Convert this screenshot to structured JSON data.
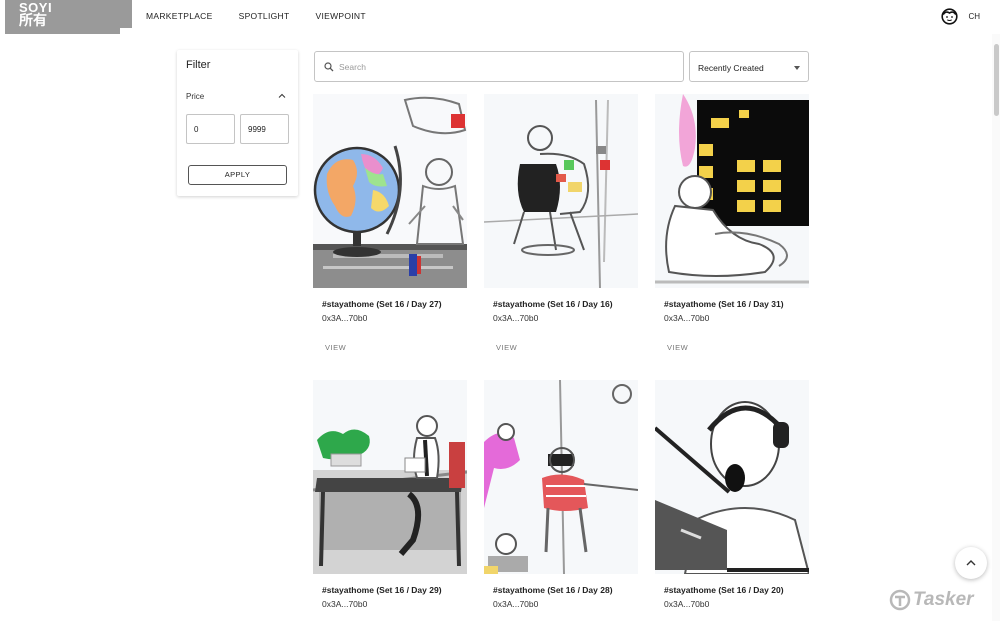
{
  "header": {
    "logo_line1": "SOYI",
    "logo_line2": "所有",
    "nav": [
      "MARKETPLACE",
      "SPOTLIGHT",
      "VIEWPOINT"
    ],
    "language": "CH"
  },
  "filter": {
    "title": "Filter",
    "price_label": "Price",
    "min_value": "0",
    "max_value": "9999",
    "apply_label": "APPLY"
  },
  "search": {
    "placeholder": "Search",
    "sort_selected": "Recently Created"
  },
  "cards": [
    {
      "title": "#stayathome (Set 16 / Day 27)",
      "owner": "0x3A...70b0",
      "action": "VIEW"
    },
    {
      "title": "#stayathome (Set 16 / Day 16)",
      "owner": "0x3A...70b0",
      "action": "VIEW"
    },
    {
      "title": "#stayathome (Set 16 / Day 31)",
      "owner": "0x3A...70b0",
      "action": "VIEW"
    },
    {
      "title": "#stayathome (Set 16 / Day 29)",
      "owner": "0x3A...70b0"
    },
    {
      "title": "#stayathome (Set 16 / Day 28)",
      "owner": "0x3A...70b0"
    },
    {
      "title": "#stayathome (Set 16 / Day 20)",
      "owner": "0x3A...70b0"
    }
  ],
  "watermark": "Tasker",
  "colors": {
    "logo_bg": "#9a9a9a",
    "border": "#c4c4c4"
  }
}
